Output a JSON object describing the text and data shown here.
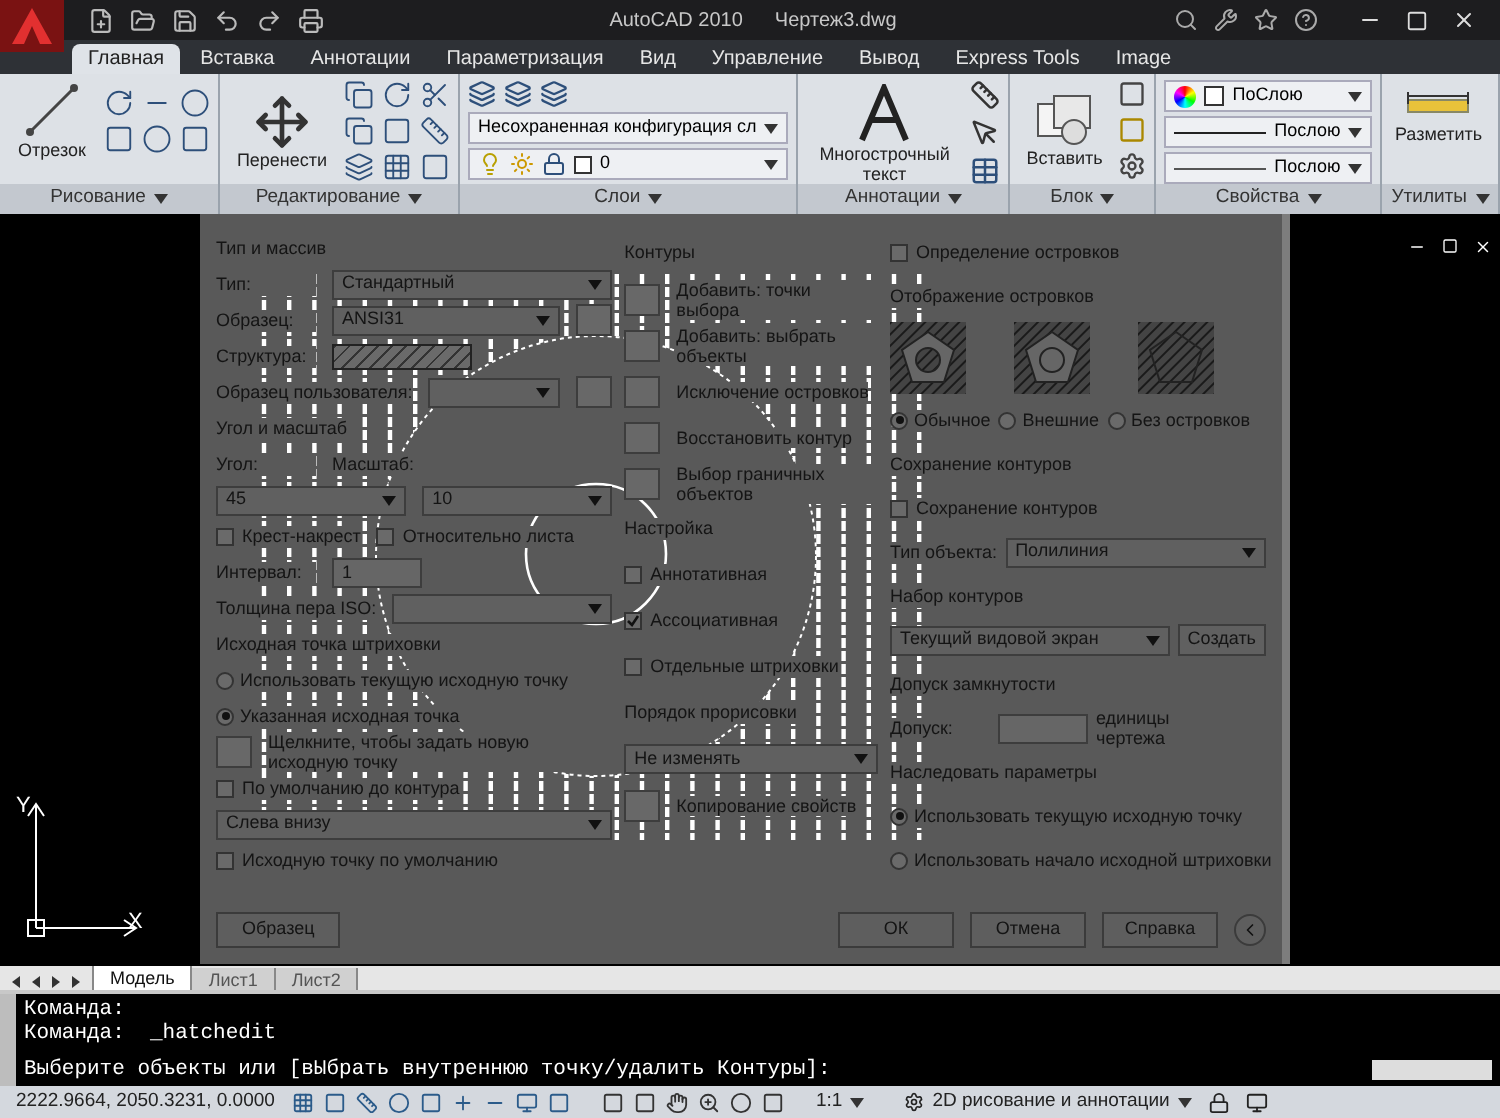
{
  "window": {
    "title": "AutoCAD 2010",
    "document": "Чертеж3.dwg"
  },
  "tabs": [
    {
      "label": "Главная",
      "selected": true
    },
    {
      "label": "Вставка",
      "selected": false
    },
    {
      "label": "Аннотации",
      "selected": false
    },
    {
      "label": "Параметризация",
      "selected": false
    },
    {
      "label": "Вид",
      "selected": false
    },
    {
      "label": "Управление",
      "selected": false
    },
    {
      "label": "Вывод",
      "selected": false
    },
    {
      "label": "Express Tools",
      "selected": false
    },
    {
      "label": "Image",
      "selected": false
    }
  ],
  "panels": [
    {
      "kind": "draw",
      "label": "Рисование",
      "big": "Отрезок"
    },
    {
      "kind": "modify",
      "label": "Редактирование",
      "big": "Перенести"
    },
    {
      "kind": "layers",
      "label": "Слои",
      "combo": "Несохраненная конфигурация сл",
      "layer": "0"
    },
    {
      "kind": "annotate",
      "label": "Аннотации",
      "big": "Многострочный текст"
    },
    {
      "kind": "block",
      "label": "Блок",
      "big": "Вставить"
    },
    {
      "kind": "properties",
      "label": "Свойства",
      "color_value": "ПоСлою",
      "linetype": "Послою",
      "lineweight": "Послою"
    },
    {
      "kind": "utilities",
      "label": "Утилиты",
      "big": "Разметить"
    }
  ],
  "dialog": {
    "columns": [
      {
        "rows": [
          {
            "items": [
              {
                "kind": "heading",
                "text": "Тип и массив"
              }
            ]
          },
          {
            "items": [
              {
                "kind": "label",
                "text": "Тип:"
              },
              {
                "kind": "combo",
                "text": "Стандартный"
              }
            ]
          },
          {
            "items": [
              {
                "kind": "label",
                "text": "Образец:"
              },
              {
                "kind": "combo",
                "text": "ANSI31"
              },
              {
                "kind": "iconbutton"
              }
            ]
          },
          {
            "items": [
              {
                "kind": "label",
                "text": "Структура:"
              },
              {
                "kind": "swatch"
              }
            ]
          },
          {
            "items": [
              {
                "kind": "label",
                "text": "Образец пользователя:"
              },
              {
                "kind": "combo"
              },
              {
                "kind": "iconbutton"
              }
            ]
          },
          {
            "items": [
              {
                "kind": "heading",
                "text": "Угол и масштаб"
              }
            ]
          },
          {
            "items": [
              {
                "kind": "label",
                "text": "Угол:"
              },
              {
                "kind": "label",
                "text": "Масштаб:"
              }
            ]
          },
          {
            "items": [
              {
                "kind": "combo",
                "text": "45"
              },
              {
                "kind": "combo",
                "text": "10"
              }
            ]
          },
          {
            "items": [
              {
                "kind": "check",
                "text": "Крест-накрест",
                "checked": false
              },
              {
                "kind": "check",
                "text": "Относительно листа",
                "checked": false
              }
            ]
          },
          {
            "items": [
              {
                "kind": "label",
                "text": "Интервал:"
              },
              {
                "kind": "field",
                "text": "1"
              }
            ]
          },
          {
            "items": [
              {
                "kind": "label",
                "text": "Толщина пера ISO:"
              },
              {
                "kind": "combo"
              }
            ]
          },
          {
            "items": [
              {
                "kind": "heading",
                "text": "Исходная точка штриховки"
              }
            ]
          },
          {
            "items": [
              {
                "kind": "radio",
                "text": "Использовать текущую исходную точку",
                "selected": false
              }
            ]
          },
          {
            "items": [
              {
                "kind": "radio",
                "text": "Указанная исходная точка",
                "selected": true
              }
            ]
          },
          {
            "items": [
              {
                "kind": "iconbutton"
              },
              {
                "kind": "text",
                "text": "Щелкните, чтобы задать новую исходную точку"
              }
            ]
          },
          {
            "items": [
              {
                "kind": "check",
                "text": "По умолчанию до контура",
                "checked": false
              }
            ]
          },
          {
            "items": [
              {
                "kind": "combo",
                "text": "Слева внизу"
              }
            ]
          },
          {
            "items": [
              {
                "kind": "check",
                "text": "Исходную точку по умолчанию",
                "checked": false
              }
            ]
          }
        ]
      },
      {
        "rows": [
          {
            "items": [
              {
                "kind": "heading",
                "text": "Контуры"
              }
            ]
          },
          {
            "items": [
              {
                "kind": "iconbutton"
              },
              {
                "kind": "text",
                "text": "Добавить: точки выбора"
              }
            ]
          },
          {
            "items": [
              {
                "kind": "iconbutton"
              },
              {
                "kind": "text",
                "text": "Добавить: выбрать объекты"
              }
            ]
          },
          {
            "items": [
              {
                "kind": "iconbutton"
              },
              {
                "kind": "text",
                "text": "Исключение островков"
              }
            ]
          },
          {
            "items": [
              {
                "kind": "iconbutton"
              },
              {
                "kind": "text",
                "text": "Восстановить контур"
              }
            ]
          },
          {
            "items": [
              {
                "kind": "iconbutton"
              },
              {
                "kind": "text",
                "text": "Выбор граничных объектов"
              }
            ]
          },
          {
            "items": [
              {
                "kind": "heading",
                "text": "Настройка"
              }
            ]
          },
          {
            "items": [
              {
                "kind": "check",
                "text": "Аннотативная",
                "checked": false
              }
            ]
          },
          {
            "items": [
              {
                "kind": "check",
                "text": "Ассоциативная",
                "checked": true
              }
            ]
          },
          {
            "items": [
              {
                "kind": "check",
                "text": "Отдельные штриховки",
                "checked": false
              }
            ]
          },
          {
            "items": [
              {
                "kind": "heading",
                "text": "Порядок прорисовки"
              }
            ]
          },
          {
            "items": [
              {
                "kind": "combo",
                "text": "Не изменять"
              }
            ]
          },
          {
            "items": [
              {
                "kind": "iconbutton"
              },
              {
                "kind": "text",
                "text": "Копирование свойств"
              }
            ]
          }
        ]
      },
      {
        "rows": [
          {
            "items": [
              {
                "kind": "check",
                "text": "Определение островков",
                "checked": false
              }
            ]
          },
          {
            "items": [
              {
                "kind": "heading",
                "text": "Отображение островков"
              }
            ]
          },
          {
            "items": [
              {
                "kind": "islands"
              }
            ]
          },
          {
            "items": [
              {
                "kind": "radio",
                "text": "Обычное",
                "selected": true
              },
              {
                "kind": "radio",
                "text": "Внешние",
                "selected": false
              },
              {
                "kind": "radio",
                "text": "Без островков",
                "selected": false
              }
            ]
          },
          {
            "items": [
              {
                "kind": "heading",
                "text": "Сохранение контуров"
              }
            ]
          },
          {
            "items": [
              {
                "kind": "check",
                "text": "Сохранение контуров",
                "checked": false
              }
            ]
          },
          {
            "items": [
              {
                "kind": "label",
                "text": "Тип объекта:"
              },
              {
                "kind": "combo",
                "text": "Полилиния"
              }
            ]
          },
          {
            "items": [
              {
                "kind": "heading",
                "text": "Набор контуров"
              }
            ]
          },
          {
            "items": [
              {
                "kind": "combo",
                "text": "Текущий видовой экран"
              },
              {
                "kind": "button",
                "text": "Создать"
              }
            ]
          },
          {
            "items": [
              {
                "kind": "heading",
                "text": "Допуск замкнутости"
              }
            ]
          },
          {
            "items": [
              {
                "kind": "label",
                "text": "Допуск:"
              },
              {
                "kind": "field"
              },
              {
                "kind": "note",
                "text": "единицы чертежа"
              }
            ]
          },
          {
            "items": [
              {
                "kind": "heading",
                "text": "Наследовать параметры"
              }
            ]
          },
          {
            "items": [
              {
                "kind": "radio",
                "text": "Использовать текущую исходную точку",
                "selected": true
              }
            ]
          },
          {
            "items": [
              {
                "kind": "radio",
                "text": "Использовать начало исходной штриховки",
                "selected": false
              }
            ]
          }
        ]
      }
    ],
    "preview_button": "Образец",
    "buttons": [
      "ОК",
      "Отмена",
      "Справка"
    ]
  },
  "ucs": {
    "x": "X",
    "y": "Y"
  },
  "layout_tabs": [
    {
      "label": "Модель",
      "selected": true
    },
    {
      "label": "Лист1",
      "selected": false
    },
    {
      "label": "Лист2",
      "selected": false
    }
  ],
  "command_lines": [
    "Команда:",
    "Команда:  _hatchedit"
  ],
  "prompt": "Выберите объекты или [вЫбрать внутреннюю точку/удалить Контуры]:",
  "status_bar": {
    "coords": "2222.9664, 2050.3231, 0.0000",
    "scale": "1:1",
    "workspace": "2D рисование и аннотации"
  }
}
